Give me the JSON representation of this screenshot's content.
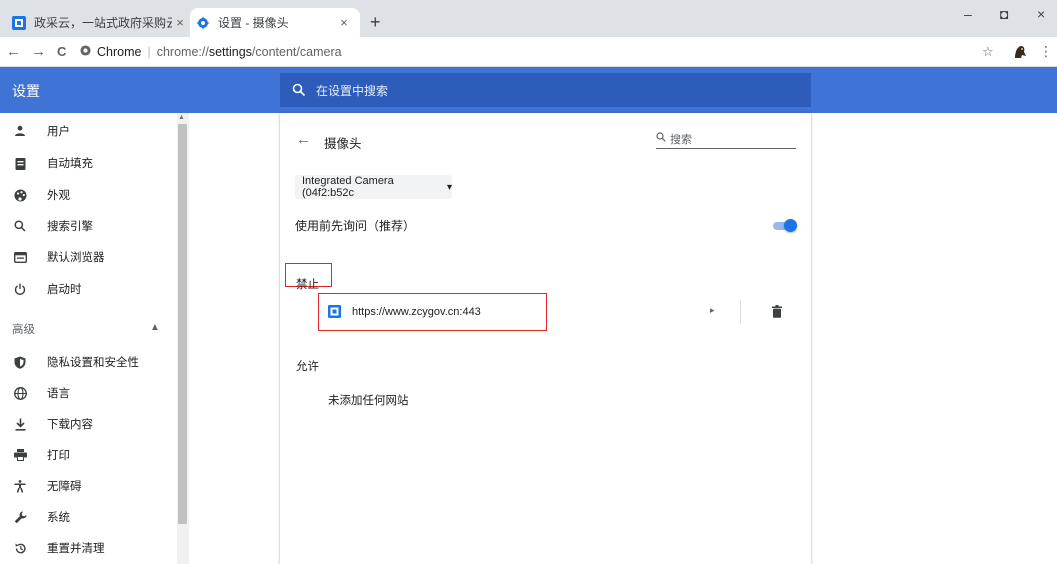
{
  "browser": {
    "tabs": [
      {
        "title": "政采云，一站式政府采购云平台",
        "active": false,
        "close": "×"
      },
      {
        "title": "设置 - 摄像头",
        "active": true,
        "close": "×"
      }
    ],
    "new_tab": "+",
    "window_controls": {
      "minimize": "–",
      "maximize": "◘",
      "close": "×"
    },
    "nav": {
      "back": "←",
      "forward": "→",
      "reload": "C"
    },
    "omnibox": {
      "site_label": "Chrome",
      "separator": "|",
      "url_prefix": "chrome://",
      "url_bold": "settings",
      "url_rest": "/content/camera"
    },
    "star": "☆",
    "menu": "⋮"
  },
  "settings": {
    "header_title": "设置",
    "search_placeholder": "在设置中搜索",
    "sidebar": {
      "items": [
        {
          "label": "用户",
          "icon": "person-icon",
          "glyph": "▲"
        },
        {
          "label": "自动填充",
          "icon": "clipboard-icon",
          "glyph": "▣"
        },
        {
          "label": "外观",
          "icon": "palette-icon",
          "glyph": "●"
        },
        {
          "label": "搜索引擎",
          "icon": "search-icon",
          "glyph": "⚲"
        },
        {
          "label": "默认浏览器",
          "icon": "browser-icon",
          "glyph": "▭"
        },
        {
          "label": "启动时",
          "icon": "power-icon",
          "glyph": "⏻"
        }
      ],
      "advanced_label": "高级",
      "advanced_caret": "▲",
      "advanced_items": [
        {
          "label": "隐私设置和安全性",
          "icon": "shield-icon",
          "glyph": "⛉"
        },
        {
          "label": "语言",
          "icon": "globe-icon",
          "glyph": "⊕"
        },
        {
          "label": "下载内容",
          "icon": "download-icon",
          "glyph": "⤓"
        },
        {
          "label": "打印",
          "icon": "printer-icon",
          "glyph": "⎙"
        },
        {
          "label": "无障碍",
          "icon": "accessibility-icon",
          "glyph": "☨"
        },
        {
          "label": "系统",
          "icon": "wrench-icon",
          "glyph": "🔧"
        },
        {
          "label": "重置并清理",
          "icon": "restore-icon",
          "glyph": "⟲"
        }
      ]
    },
    "camera_page": {
      "back": "←",
      "title": "摄像头",
      "search_placeholder": "搜索",
      "camera_select": "Integrated Camera (04f2:b52c",
      "camera_caret": "▾",
      "ask_label": "使用前先询问（推荐）",
      "ask_enabled": true,
      "block_label": "禁止",
      "blocked_sites": [
        {
          "url": "https://www.zcygov.cn:443",
          "arrow": "▸"
        }
      ],
      "allow_label": "允许",
      "allow_empty": "未添加任何网站"
    }
  },
  "colors": {
    "accent": "#1a73e8",
    "header_blue": "#3f73d5",
    "search_blue": "#2d5cbb",
    "highlight_red": "#e0262b"
  }
}
